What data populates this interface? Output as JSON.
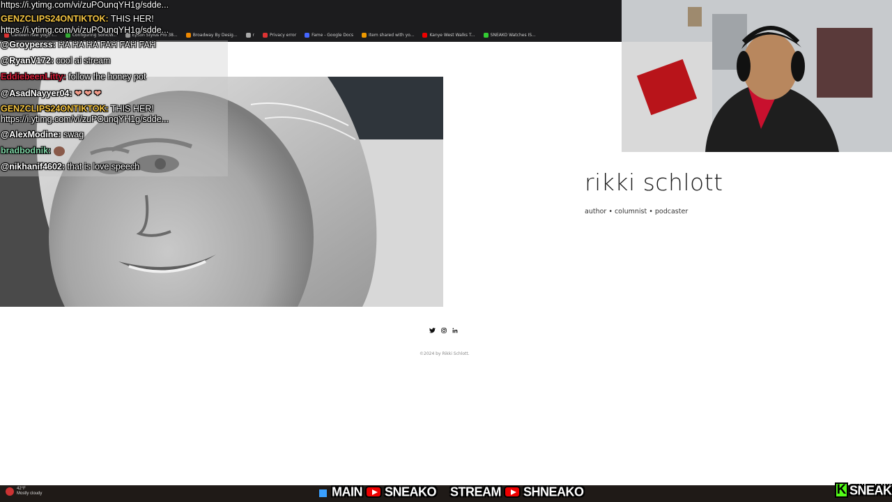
{
  "bookmarks": [
    "Canteen Raw yoga i...",
    "Configuring SonicW...",
    "Epson Stylus Pro 38...",
    "Broadway By Desig...",
    "r",
    "Privacy error",
    "Fame - Google Docs",
    "Item shared with yo...",
    "Kanye West Walks T...",
    "SNEAKO Watches IS..."
  ],
  "site": {
    "name": "rikki schlott",
    "tagline": "author • columnist • podcaster",
    "socials": [
      "twitter-icon",
      "instagram-icon",
      "linkedin-icon"
    ],
    "copyright": "©2024 by Rikki Schlott."
  },
  "chat": [
    {
      "user": "",
      "text": "https://i.ytimg.com/vi/zuPOunqYH1g/sdde...",
      "color": "#ffffff"
    },
    {
      "user": "GENZCLIPS24ONTIKTOK:",
      "text": " THIS HER!",
      "color": "#f5c542"
    },
    {
      "user": "",
      "text": "https://i.ytimg.com/vi/zuPOunqYH1g/sdde...",
      "color": "#ffffff"
    },
    {
      "user": "@Groyperss:",
      "text": " HA HA HA FAH FAH FAH",
      "color": "#ffffff"
    },
    {
      "user": "@RyanV172:",
      "text": " cool ai stream",
      "color": "#ffffff"
    },
    {
      "user": "EddiebeenLitty:",
      "text": " follow the honey pot",
      "color": "#d41f3a"
    },
    {
      "user": "@AsadNayyer04:",
      "text": "",
      "color": "#ffffff"
    },
    {
      "user": "GENZCLIPS24ONTIKTOK:",
      "text": " THIS HER!",
      "color": "#f5c542"
    },
    {
      "user": "",
      "text": "https://i.ytimg.com/vi/zuPOunqYH1g/sdde...",
      "color": "#ffffff"
    },
    {
      "user": "@AlexModine:",
      "text": " swag",
      "color": "#ffffff"
    },
    {
      "user": "bradbodnik:",
      "text": "",
      "color": "#7fd6a6"
    },
    {
      "user": "@nikhanif4602:",
      "text": " that is love speech",
      "color": "#ffffff"
    }
  ],
  "taskbar": {
    "temp": "42°F",
    "weather": "Mostly cloudy"
  },
  "overlay": {
    "w1": "MAIN",
    "w2": "SNEAKO",
    "w3": "STREAM",
    "w4": "SHNEAKO",
    "kick": "SNEAKO"
  }
}
